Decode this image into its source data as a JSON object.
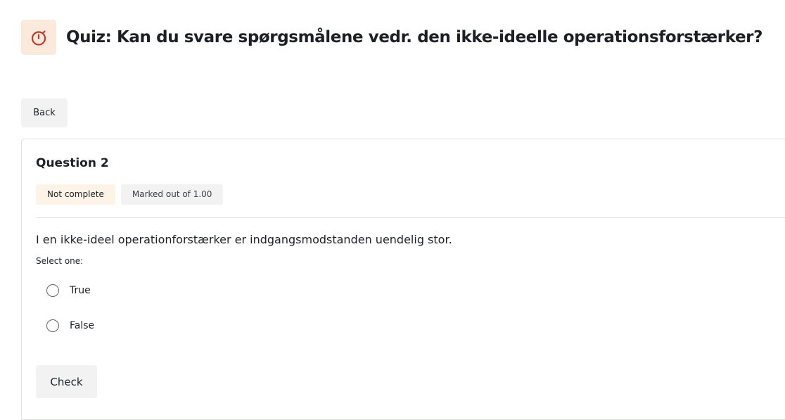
{
  "header": {
    "title": "Quiz: Kan du svare spørgsmålene vedr. den ikke-ideelle operationsforstærker?",
    "icon": "stopwatch-icon",
    "icon_color": "#c0392b",
    "icon_bg": "#fbe9dc"
  },
  "nav": {
    "back_label": "Back"
  },
  "question": {
    "number_label": "Question 2",
    "state_label": "Not complete",
    "grade_label": "Marked out of 1.00",
    "text": "I en ikke-ideel operationforstærker er indgangsmodstanden uendelig stor.",
    "prompt": "Select one:",
    "options": [
      {
        "label": "True",
        "selected": false
      },
      {
        "label": "False",
        "selected": false
      }
    ],
    "check_label": "Check"
  }
}
